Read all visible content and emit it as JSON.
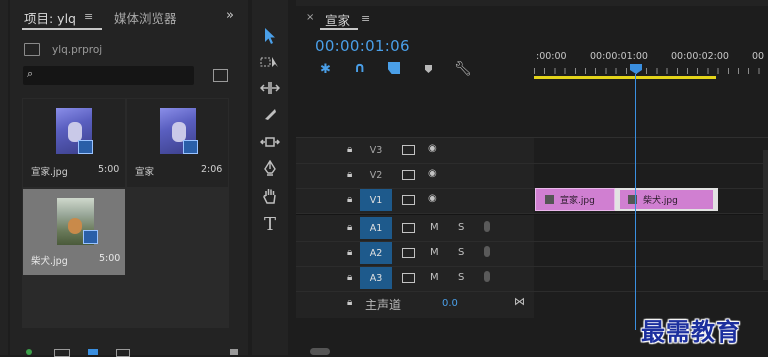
{
  "project_panel": {
    "tab_project": "项目: ylq",
    "tab_media_browser": "媒体浏览器",
    "project_file": "ylq.prproj",
    "search_placeholder": "",
    "items": [
      {
        "name": "宣家.jpg",
        "duration": "5:00"
      },
      {
        "name": "宣家",
        "duration": "2:06"
      },
      {
        "name": "柴犬.jpg",
        "duration": "5:00"
      }
    ]
  },
  "timeline": {
    "tab_title": "宣家",
    "timecode": "00:00:01:06",
    "ruler_labels": [
      ":00:00",
      "00:00:01:00",
      "00:00:02:00",
      "00"
    ],
    "video_tracks": [
      "V3",
      "V2",
      "V1"
    ],
    "audio_tracks": [
      "A1",
      "A2",
      "A3"
    ],
    "mute_label": "M",
    "solo_label": "S",
    "master_label": "主声道",
    "master_value": "0.0",
    "clips": [
      "宣家.jpg",
      "柴犬.jpg"
    ],
    "playhead_color": "#3a8fe0",
    "clip_color": "#d07fd1",
    "timecode_color": "#4a9fe8"
  },
  "watermark": "最需教育",
  "tools": [
    "selection-tool",
    "track-select-tool",
    "ripple-edit-tool",
    "razor-tool",
    "slip-tool",
    "pen-tool",
    "hand-tool",
    "type-tool"
  ]
}
